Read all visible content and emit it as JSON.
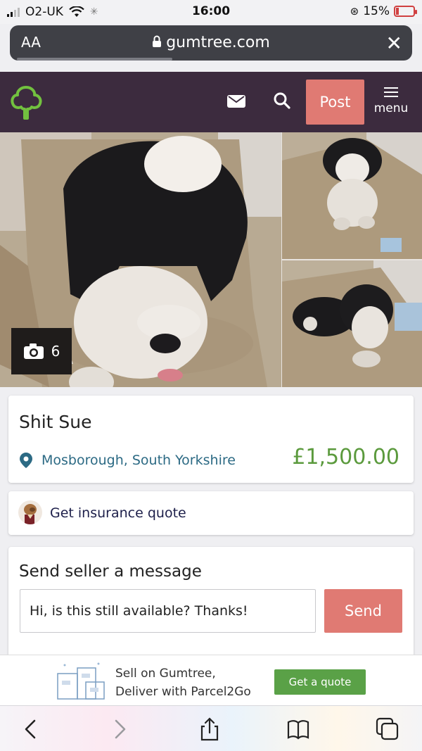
{
  "status_bar": {
    "carrier": "O2-UK",
    "time": "16:00",
    "battery": "15%",
    "battery_level": 0.15
  },
  "browser": {
    "text_size_label": "AA",
    "domain": "gumtree.com",
    "close_icon": "close-icon",
    "load_progress": 0.4
  },
  "header": {
    "logo": "gumtree-tree-logo",
    "post_label": "Post",
    "menu_label": "menu",
    "colors": {
      "bar": "#3c2b3e",
      "post": "#e07a73",
      "logo": "#72c13f"
    }
  },
  "gallery": {
    "photo_count": "6"
  },
  "listing": {
    "title": "Shit Sue",
    "location": "Mosborough, South Yorkshire",
    "price": "£1,500.00",
    "price_color": "#5b9a3d"
  },
  "insurance": {
    "label": "Get insurance quote"
  },
  "message": {
    "title": "Send seller a message",
    "input_value": "Hi, is this still available? Thanks!",
    "send_label": "Send"
  },
  "promo": {
    "line1": "Sell on Gumtree,",
    "line2": "Deliver with Parcel2Go",
    "button_label": "Get a quote"
  },
  "toolbar": {
    "icons": [
      "back-icon",
      "forward-icon",
      "share-icon",
      "bookmarks-icon",
      "tabs-icon"
    ]
  }
}
